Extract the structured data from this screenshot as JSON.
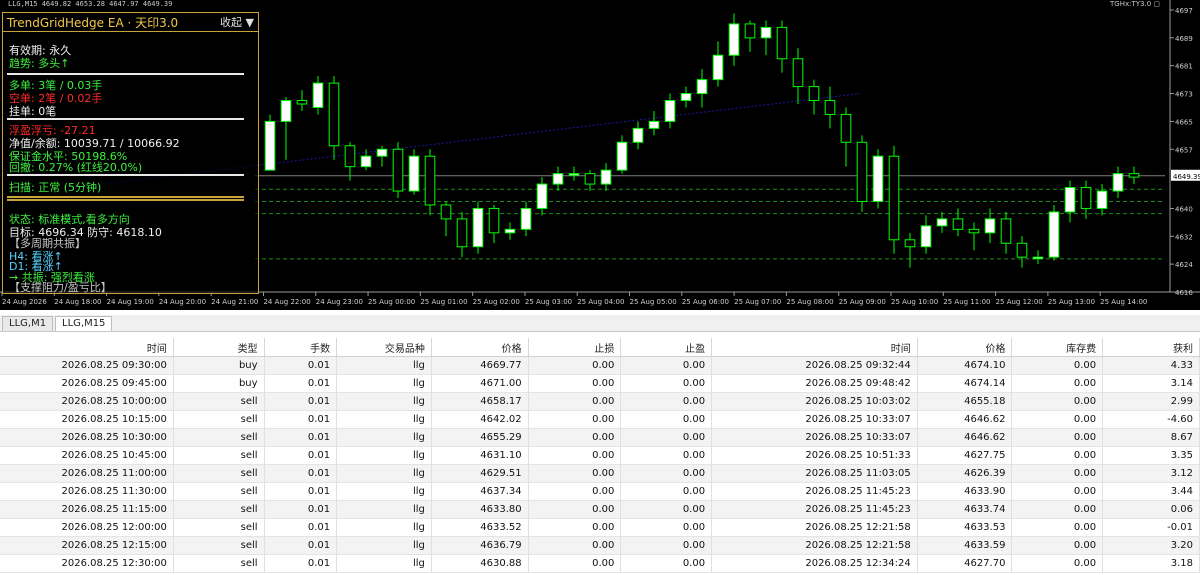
{
  "window": {
    "chart_header": "LLG,M15  4649.82 4653.28 4647.97 4649.39",
    "indicator_header": "TGHx:TY3.0 ▢"
  },
  "ea_panel": {
    "title": "TrendGridHedge EA · 天印3.0",
    "collapse_label": "收起 ▼",
    "validity": "有效期: 永久",
    "trend": "趋势: 多头↑",
    "long": "多单: 3笔 / 0.03手",
    "short": "空单: 2笔 / 0.02手",
    "pending": "挂单: 0笔",
    "floating": "浮盈浮亏: -27.21",
    "equity": "净值/余额: 10039.71 / 10066.92",
    "margin": "保证金水平: 50198.6%",
    "drawdown": "回撤: 0.27% (红线20.0%)",
    "scan": "扫描: 正常 (5分钟)",
    "status": "状态: 标准模式,看多方向",
    "target": "目标: 4696.34  防守: 4618.10",
    "cycle": "【多周期共振】",
    "h4": "H4: 看涨↑",
    "d1": "D1: 看涨↑",
    "resonance": "→ 共振: 强烈看涨",
    "support": "【支撑阻力/盈亏比】",
    "colors": {
      "gold": "#c8a23c",
      "green": "#3df03d",
      "red": "#ff2a2a",
      "cyan": "#56d4ff"
    }
  },
  "chart": {
    "price_ticks": [
      "4697",
      "4689",
      "4681",
      "4673",
      "4665",
      "4657",
      "4649.39",
      "4640",
      "4632",
      "4624",
      "4616"
    ],
    "time_ticks": [
      "24 Aug 2026",
      "24 Aug 18:00",
      "24 Aug 19:00",
      "24 Aug 20:00",
      "24 Aug 21:00",
      "24 Aug 22:00",
      "24 Aug 23:00",
      "25 Aug 00:00",
      "25 Aug 01:00",
      "25 Aug 02:00",
      "25 Aug 03:00",
      "25 Aug 04:00",
      "25 Aug 05:00",
      "25 Aug 06:00",
      "25 Aug 07:00",
      "25 Aug 08:00",
      "25 Aug 09:00",
      "25 Aug 10:00",
      "25 Aug 11:00",
      "25 Aug 12:00",
      "25 Aug 13:00",
      "25 Aug 14:00"
    ],
    "current_price": "4649.39",
    "colors": {
      "background": "#000000",
      "bull": "#ffffff",
      "bear": "#000000",
      "wick": "#00ff00",
      "grid_line": "#1e8c1e",
      "trend_line": "#1a1aa0"
    }
  },
  "chart_data": {
    "type": "candlestick",
    "symbol": "LLG",
    "timeframe": "M15",
    "ylim": [
      4616,
      4697
    ],
    "candles": [
      [
        4651,
        4665,
        4660,
        4667
      ],
      [
        4665,
        4671,
        4654,
        4672
      ],
      [
        4671,
        4670,
        4668,
        4674
      ],
      [
        4669,
        4676,
        4667,
        4678
      ],
      [
        4676,
        4658,
        4654,
        4678
      ],
      [
        4658,
        4652,
        4648,
        4659
      ],
      [
        4652,
        4655,
        4651,
        4657
      ],
      [
        4655,
        4657,
        4652,
        4658
      ],
      [
        4657,
        4645,
        4643,
        4659
      ],
      [
        4645,
        4655,
        4644,
        4657
      ],
      [
        4655,
        4641,
        4638,
        4657
      ],
      [
        4641,
        4637,
        4632,
        4642
      ],
      [
        4637,
        4629,
        4626,
        4639
      ],
      [
        4629,
        4640,
        4627,
        4642
      ],
      [
        4640,
        4633,
        4630,
        4641
      ],
      [
        4633,
        4634,
        4631,
        4636
      ],
      [
        4634,
        4640,
        4632,
        4642
      ],
      [
        4640,
        4647,
        4638,
        4649
      ],
      [
        4647,
        4650,
        4645,
        4652
      ],
      [
        4650,
        4650,
        4648,
        4652
      ],
      [
        4650,
        4647,
        4645,
        4651
      ],
      [
        4647,
        4651,
        4645,
        4653
      ],
      [
        4651,
        4659,
        4650,
        4661
      ],
      [
        4659,
        4663,
        4657,
        4665
      ],
      [
        4663,
        4665,
        4661,
        4668
      ],
      [
        4665,
        4671,
        4663,
        4673
      ],
      [
        4671,
        4673,
        4669,
        4675
      ],
      [
        4673,
        4677,
        4669,
        4680
      ],
      [
        4677,
        4684,
        4675,
        4688
      ],
      [
        4684,
        4693,
        4681,
        4696
      ],
      [
        4693,
        4689,
        4685,
        4694
      ],
      [
        4689,
        4692,
        4684,
        4694
      ],
      [
        4692,
        4683,
        4679,
        4694
      ],
      [
        4683,
        4675,
        4670,
        4686
      ],
      [
        4675,
        4671,
        4667,
        4677
      ],
      [
        4671,
        4667,
        4663,
        4675
      ],
      [
        4667,
        4659,
        4652,
        4669
      ],
      [
        4659,
        4642,
        4639,
        4661
      ],
      [
        4642,
        4655,
        4640,
        4657
      ],
      [
        4655,
        4631,
        4627,
        4658
      ],
      [
        4631,
        4629,
        4623,
        4633
      ],
      [
        4629,
        4635,
        4627,
        4638
      ],
      [
        4635,
        4637,
        4633,
        4639
      ],
      [
        4637,
        4634,
        4632,
        4640
      ],
      [
        4634,
        4633,
        4628,
        4636
      ],
      [
        4633,
        4637,
        4630,
        4640
      ],
      [
        4637,
        4630,
        4627,
        4639
      ],
      [
        4630,
        4626,
        4623,
        4632
      ],
      [
        4626,
        4626,
        4624,
        4628
      ],
      [
        4626,
        4639,
        4625,
        4641
      ],
      [
        4639,
        4646,
        4636,
        4648
      ],
      [
        4646,
        4640,
        4637,
        4648
      ],
      [
        4640,
        4645,
        4638,
        4647
      ],
      [
        4645,
        4650,
        4643,
        4652
      ],
      [
        4650,
        4649,
        4647,
        4652
      ]
    ],
    "horizontal_levels": [
      4649.39,
      4645.5,
      4642,
      4638.5,
      4625.5
    ]
  },
  "tabs": [
    {
      "label": "LLG,M1"
    },
    {
      "label": "LLG,M15"
    }
  ],
  "table": {
    "columns": [
      "时间",
      "类型",
      "手数",
      "交易品种",
      "价格",
      "止损",
      "止盈",
      "时间",
      "价格",
      "库存费",
      "获利"
    ],
    "rows": [
      [
        "2026.08.25 09:30:00",
        "buy",
        "0.01",
        "llg",
        "4669.77",
        "0.00",
        "0.00",
        "2026.08.25 09:32:44",
        "4674.10",
        "0.00",
        "4.33"
      ],
      [
        "2026.08.25 09:45:00",
        "buy",
        "0.01",
        "llg",
        "4671.00",
        "0.00",
        "0.00",
        "2026.08.25 09:48:42",
        "4674.14",
        "0.00",
        "3.14"
      ],
      [
        "2026.08.25 10:00:00",
        "sell",
        "0.01",
        "llg",
        "4658.17",
        "0.00",
        "0.00",
        "2026.08.25 10:03:02",
        "4655.18",
        "0.00",
        "2.99"
      ],
      [
        "2026.08.25 10:15:00",
        "sell",
        "0.01",
        "llg",
        "4642.02",
        "0.00",
        "0.00",
        "2026.08.25 10:33:07",
        "4646.62",
        "0.00",
        "-4.60"
      ],
      [
        "2026.08.25 10:30:00",
        "sell",
        "0.01",
        "llg",
        "4655.29",
        "0.00",
        "0.00",
        "2026.08.25 10:33:07",
        "4646.62",
        "0.00",
        "8.67"
      ],
      [
        "2026.08.25 10:45:00",
        "sell",
        "0.01",
        "llg",
        "4631.10",
        "0.00",
        "0.00",
        "2026.08.25 10:51:33",
        "4627.75",
        "0.00",
        "3.35"
      ],
      [
        "2026.08.25 11:00:00",
        "sell",
        "0.01",
        "llg",
        "4629.51",
        "0.00",
        "0.00",
        "2026.08.25 11:03:05",
        "4626.39",
        "0.00",
        "3.12"
      ],
      [
        "2026.08.25 11:30:00",
        "sell",
        "0.01",
        "llg",
        "4637.34",
        "0.00",
        "0.00",
        "2026.08.25 11:45:23",
        "4633.90",
        "0.00",
        "3.44"
      ],
      [
        "2026.08.25 11:15:00",
        "sell",
        "0.01",
        "llg",
        "4633.80",
        "0.00",
        "0.00",
        "2026.08.25 11:45:23",
        "4633.74",
        "0.00",
        "0.06"
      ],
      [
        "2026.08.25 12:00:00",
        "sell",
        "0.01",
        "llg",
        "4633.52",
        "0.00",
        "0.00",
        "2026.08.25 12:21:58",
        "4633.53",
        "0.00",
        "-0.01"
      ],
      [
        "2026.08.25 12:15:00",
        "sell",
        "0.01",
        "llg",
        "4636.79",
        "0.00",
        "0.00",
        "2026.08.25 12:21:58",
        "4633.59",
        "0.00",
        "3.20"
      ],
      [
        "2026.08.25 12:30:00",
        "sell",
        "0.01",
        "llg",
        "4630.88",
        "0.00",
        "0.00",
        "2026.08.25 12:34:24",
        "4627.70",
        "0.00",
        "3.18"
      ]
    ]
  }
}
